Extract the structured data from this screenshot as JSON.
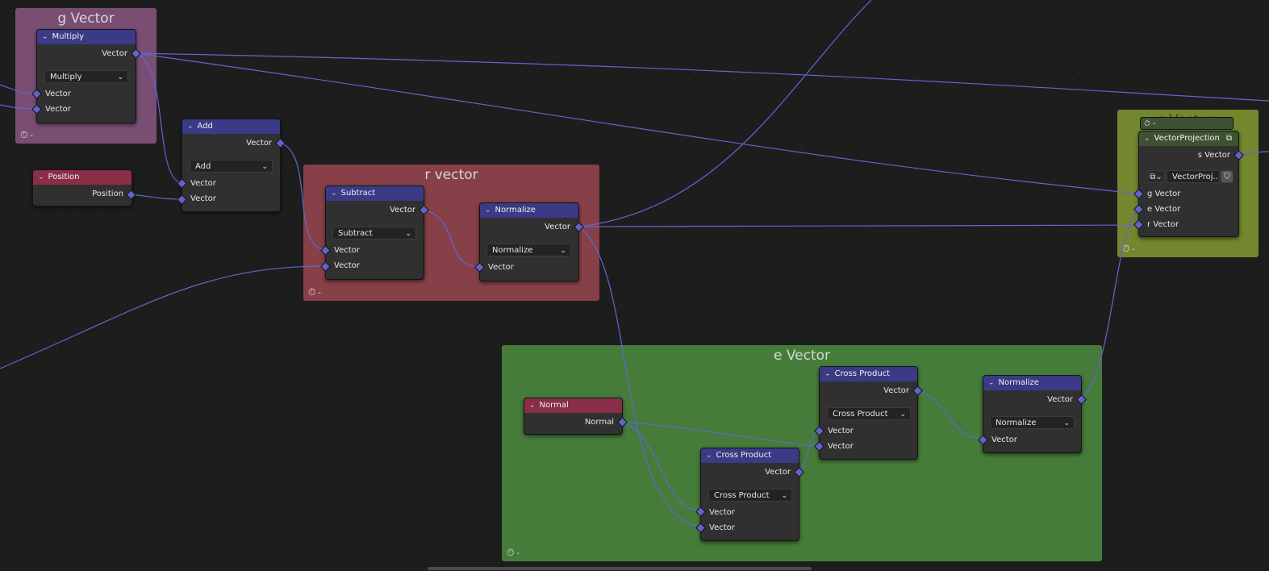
{
  "colors": {
    "background": "#1d1d1d",
    "link": "#6464d2",
    "socket": "#6363c7",
    "header_vector_math": "#3a3a86",
    "header_input": "#8a2e48",
    "header_group": "#3d5232",
    "frame_g": "#7a4e73",
    "frame_r": "#874047",
    "frame_e": "#457c39",
    "frame_s": "#72872e"
  },
  "icons": {
    "collapse": "chevron-down-icon",
    "frame_footer": "stopwatch-icon",
    "group": "node-group-icon",
    "fake_user": "shield-icon"
  },
  "frames": {
    "g": {
      "title": "g Vector",
      "footer": "-"
    },
    "r": {
      "title": "r vector",
      "footer": "-"
    },
    "e": {
      "title": "e Vector",
      "footer": "-"
    },
    "s": {
      "title": "s Vector",
      "footer": "-"
    }
  },
  "nodes": {
    "multiply": {
      "title": "Multiply",
      "output": "Vector",
      "operation": "Multiply",
      "in1": "Vector",
      "in2": "Vector"
    },
    "add": {
      "title": "Add",
      "output": "Vector",
      "operation": "Add",
      "in1": "Vector",
      "in2": "Vector"
    },
    "position": {
      "title": "Position",
      "output": "Position"
    },
    "subtract": {
      "title": "Subtract",
      "output": "Vector",
      "operation": "Subtract",
      "in1": "Vector",
      "in2": "Vector"
    },
    "normalize_r": {
      "title": "Normalize",
      "output": "Vector",
      "operation": "Normalize",
      "in1": "Vector"
    },
    "normal": {
      "title": "Normal",
      "output": "Normal"
    },
    "cross1": {
      "title": "Cross Product",
      "output": "Vector",
      "operation": "Cross Product",
      "in1": "Vector",
      "in2": "Vector"
    },
    "cross2": {
      "title": "Cross Product",
      "output": "Vector",
      "operation": "Cross Product",
      "in1": "Vector",
      "in2": "Vector"
    },
    "normalize_e": {
      "title": "Normalize",
      "output": "Vector",
      "operation": "Normalize",
      "in1": "Vector"
    },
    "projection": {
      "title": "VectorProjection",
      "output": "s Vector",
      "group_name": "VectorProj...",
      "in1": "g Vector",
      "in2": "e Vector",
      "in3": "r Vector"
    }
  }
}
